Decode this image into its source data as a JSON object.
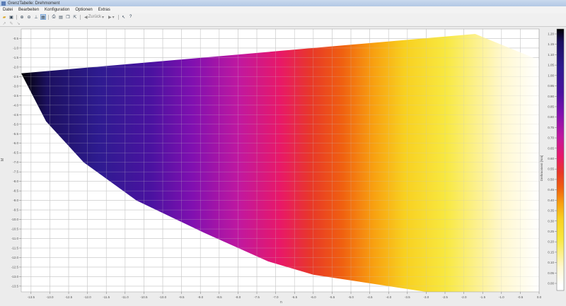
{
  "window": {
    "title": "GrenzTabelle: Drehmoment"
  },
  "menu": [
    "Datei",
    "Bearbeiten",
    "Konfiguration",
    "Optionen",
    "Extras"
  ],
  "toolbar": {
    "back_label": "Zurück"
  },
  "chart_data": {
    "type": "heatmap",
    "xlabel": "n",
    "ylabel": "M",
    "colorbar_label": "Drehmoment [Nm]",
    "xlim": [
      -13.76,
      0.0
    ],
    "ylim": [
      -13.8,
      0.0
    ],
    "x_ticks": [
      "-13.5",
      "-13.0",
      "-12.5",
      "-12.0",
      "-11.5",
      "-11.0",
      "-10.5",
      "-10.0",
      "-9.5",
      "-9.0",
      "-8.5",
      "-8.0",
      "-7.5",
      "-7.0",
      "-6.5",
      "-6.0",
      "-5.5",
      "-5.0",
      "-4.5",
      "-4.0",
      "-3.5",
      "-3.0",
      "-2.5",
      "-2.0",
      "-1.5",
      "-1.0",
      "-0.5",
      "0.0"
    ],
    "y_ticks": [
      "-0.5",
      "-1.0",
      "-1.5",
      "-2.0",
      "-2.5",
      "-3.0",
      "-3.5",
      "-4.0",
      "-4.5",
      "-5.0",
      "-5.5",
      "-6.0",
      "-6.5",
      "-7.0",
      "-7.5",
      "-8.0",
      "-8.5",
      "-9.0",
      "-9.5",
      "-10.0",
      "-10.5",
      "-11.0",
      "-11.5",
      "-12.0",
      "-12.5",
      "-13.0",
      "-13.5"
    ],
    "colorbar_ticks": [
      "1.20",
      "1.15",
      "1.10",
      "1.05",
      "1.00",
      "0.95",
      "0.90",
      "0.85",
      "0.80",
      "0.75",
      "0.70",
      "0.65",
      "0.60",
      "0.55",
      "0.50",
      "0.45",
      "0.40",
      "0.35",
      "0.30",
      "0.25",
      "0.20",
      "0.15",
      "0.10",
      "0.05",
      "0.00"
    ],
    "colorbar_range": [
      0.0,
      1.2
    ],
    "region_boundary": [
      [
        -13.76,
        -2.33
      ],
      [
        -1.7,
        -0.26
      ],
      [
        0.0,
        -1.63
      ],
      [
        0.0,
        -13.8
      ],
      [
        -3.0,
        -13.8
      ],
      [
        -4.5,
        -13.35
      ],
      [
        -6.0,
        -12.9
      ],
      [
        -7.2,
        -12.2
      ],
      [
        -8.9,
        -10.7
      ],
      [
        -10.7,
        -9.0
      ],
      [
        -12.1,
        -7.0
      ],
      [
        -13.1,
        -4.85
      ]
    ],
    "colormap": [
      "#000000",
      "#1c1060",
      "#2e1b90",
      "#4a12a0",
      "#8010b0",
      "#c018a0",
      "#e81868",
      "#e83828",
      "#f06010",
      "#f8a010",
      "#f8d020",
      "#f8e840",
      "#fff8d0",
      "#ffffff"
    ]
  }
}
